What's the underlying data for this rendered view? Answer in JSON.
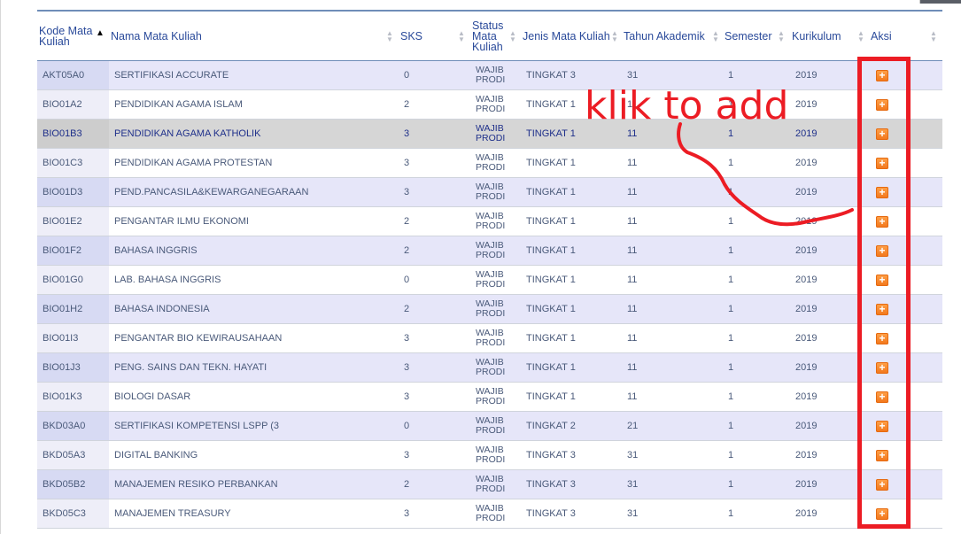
{
  "table": {
    "columns": [
      {
        "key": "kode",
        "label": "Kode Mata\nKuliah",
        "sort": "asc"
      },
      {
        "key": "nama",
        "label": "Nama Mata Kuliah",
        "sort": "none"
      },
      {
        "key": "sks",
        "label": "SKS",
        "sort": "none"
      },
      {
        "key": "status",
        "label": "Status\nMata\nKuliah",
        "sort": "none"
      },
      {
        "key": "jenis",
        "label": "Jenis Mata Kuliah",
        "sort": "none"
      },
      {
        "key": "tahun",
        "label": "Tahun Akademik",
        "sort": "none"
      },
      {
        "key": "semester",
        "label": "Semester",
        "sort": "none"
      },
      {
        "key": "kurikulum",
        "label": "Kurikulum",
        "sort": "none"
      },
      {
        "key": "aksi",
        "label": "Aksi",
        "sort": "none"
      }
    ],
    "rows": [
      {
        "kode": "AKT05A0",
        "nama": "SERTIFIKASI ACCURATE",
        "sks": "0",
        "status": [
          "WAJIB",
          "PRODI"
        ],
        "jenis": "TINGKAT 3",
        "tahun": "31",
        "semester": "1",
        "kurikulum": "2019"
      },
      {
        "kode": "BIO01A2",
        "nama": "PENDIDIKAN AGAMA ISLAM",
        "sks": "2",
        "status": [
          "WAJIB",
          "PRODI"
        ],
        "jenis": "TINGKAT 1",
        "tahun": "11",
        "semester": "1",
        "kurikulum": "2019"
      },
      {
        "kode": "BIO01B3",
        "nama": "PENDIDIKAN AGAMA KATHOLIK",
        "sks": "3",
        "status": [
          "WAJIB",
          "PRODI"
        ],
        "jenis": "TINGKAT 1",
        "tahun": "11",
        "semester": "1",
        "kurikulum": "2019",
        "selected": true
      },
      {
        "kode": "BIO01C3",
        "nama": "PENDIDIKAN AGAMA PROTESTAN",
        "sks": "3",
        "status": [
          "WAJIB",
          "PRODI"
        ],
        "jenis": "TINGKAT 1",
        "tahun": "11",
        "semester": "1",
        "kurikulum": "2019"
      },
      {
        "kode": "BIO01D3",
        "nama": "PEND.PANCASILA&KEWARGANEGARAAN",
        "sks": "3",
        "status": [
          "WAJIB",
          "PRODI"
        ],
        "jenis": "TINGKAT 1",
        "tahun": "11",
        "semester": "1",
        "kurikulum": "2019"
      },
      {
        "kode": "BIO01E2",
        "nama": "PENGANTAR ILMU EKONOMI",
        "sks": "2",
        "status": [
          "WAJIB",
          "PRODI"
        ],
        "jenis": "TINGKAT 1",
        "tahun": "11",
        "semester": "1",
        "kurikulum": "2019"
      },
      {
        "kode": "BIO01F2",
        "nama": "BAHASA INGGRIS",
        "sks": "2",
        "status": [
          "WAJIB",
          "PRODI"
        ],
        "jenis": "TINGKAT 1",
        "tahun": "11",
        "semester": "1",
        "kurikulum": "2019"
      },
      {
        "kode": "BIO01G0",
        "nama": "LAB. BAHASA INGGRIS",
        "sks": "0",
        "status": [
          "WAJIB",
          "PRODI"
        ],
        "jenis": "TINGKAT 1",
        "tahun": "11",
        "semester": "1",
        "kurikulum": "2019"
      },
      {
        "kode": "BIO01H2",
        "nama": "BAHASA INDONESIA",
        "sks": "2",
        "status": [
          "WAJIB",
          "PRODI"
        ],
        "jenis": "TINGKAT 1",
        "tahun": "11",
        "semester": "1",
        "kurikulum": "2019"
      },
      {
        "kode": "BIO01I3",
        "nama": "PENGANTAR BIO KEWIRAUSAHAAN",
        "sks": "3",
        "status": [
          "WAJIB",
          "PRODI"
        ],
        "jenis": "TINGKAT 1",
        "tahun": "11",
        "semester": "1",
        "kurikulum": "2019"
      },
      {
        "kode": "BIO01J3",
        "nama": "PENG. SAINS DAN TEKN. HAYATI",
        "sks": "3",
        "status": [
          "WAJIB",
          "PRODI"
        ],
        "jenis": "TINGKAT 1",
        "tahun": "11",
        "semester": "1",
        "kurikulum": "2019"
      },
      {
        "kode": "BIO01K3",
        "nama": "BIOLOGI DASAR",
        "sks": "3",
        "status": [
          "WAJIB",
          "PRODI"
        ],
        "jenis": "TINGKAT 1",
        "tahun": "11",
        "semester": "1",
        "kurikulum": "2019"
      },
      {
        "kode": "BKD03A0",
        "nama": "SERTIFIKASI KOMPETENSI LSPP (3",
        "sks": "0",
        "status": [
          "WAJIB",
          "PRODI"
        ],
        "jenis": "TINGKAT 2",
        "tahun": "21",
        "semester": "1",
        "kurikulum": "2019"
      },
      {
        "kode": "BKD05A3",
        "nama": "DIGITAL BANKING",
        "sks": "3",
        "status": [
          "WAJIB",
          "PRODI"
        ],
        "jenis": "TINGKAT 3",
        "tahun": "31",
        "semester": "1",
        "kurikulum": "2019"
      },
      {
        "kode": "BKD05B2",
        "nama": "MANAJEMEN RESIKO PERBANKAN",
        "sks": "2",
        "status": [
          "WAJIB",
          "PRODI"
        ],
        "jenis": "TINGKAT 3",
        "tahun": "31",
        "semester": "1",
        "kurikulum": "2019"
      },
      {
        "kode": "BKD05C3",
        "nama": "MANAJEMEN TREASURY",
        "sks": "3",
        "status": [
          "WAJIB",
          "PRODI"
        ],
        "jenis": "TINGKAT 3",
        "tahun": "31",
        "semester": "1",
        "kurikulum": "2019"
      }
    ],
    "add_icon": "plus-icon",
    "add_glyph": "+"
  },
  "annotation": {
    "text": "klik to add",
    "color": "#ec1c24"
  },
  "colors": {
    "header_text": "#2a4a9a",
    "row_odd": "#e6e6f9",
    "row_selected": "#d6d6d6",
    "add_button": "#f2751a"
  }
}
